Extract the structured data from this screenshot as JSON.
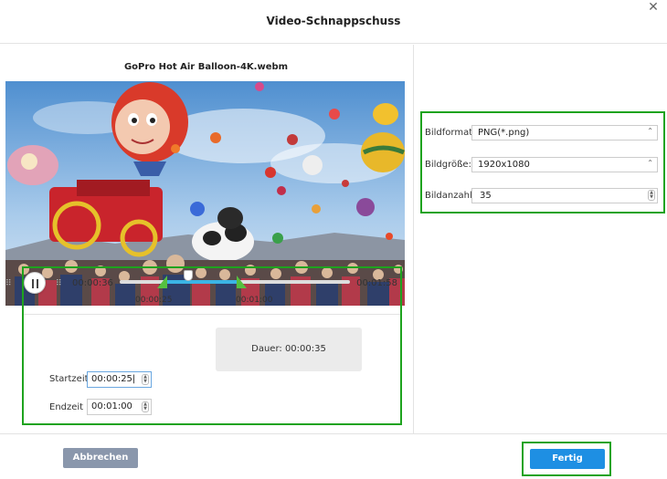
{
  "dialog": {
    "title": "Video-Schnappschuss",
    "close_glyph": "✕"
  },
  "video": {
    "filename": "GoPro Hot Air Balloon-4K.webm"
  },
  "player": {
    "current_time": "00:00:36",
    "total_time": "00:01:58",
    "start_marker": "00:00:25",
    "end_marker": "00:01:00",
    "state": "playing"
  },
  "trim": {
    "start_label": "Startzeit",
    "start_value": "00:00:25",
    "end_label": "Endzeit",
    "end_value": "00:01:00",
    "duration_label": "Dauer:",
    "duration_value": "00:00:35"
  },
  "settings": {
    "format_label": "Bildformat:",
    "format_value": "PNG(*.png)",
    "size_label": "Bildgröße:",
    "size_value": "1920x1080",
    "count_label": "Bildanzahl:",
    "count_value": "35"
  },
  "footer": {
    "cancel_label": "Abbrechen",
    "ok_label": "Fertig"
  },
  "icons": {
    "close": "close-icon",
    "pause": "pause-icon",
    "grip": "grip-icon",
    "chevron": "chevron-updown-icon",
    "spinner": "spinner-icon"
  },
  "colors": {
    "highlight": "#1ea31e",
    "accent": "#1e8fe3",
    "track_selection": "#3bb4e5",
    "marker": "#55c03f",
    "cancel": "#8a97ac"
  }
}
